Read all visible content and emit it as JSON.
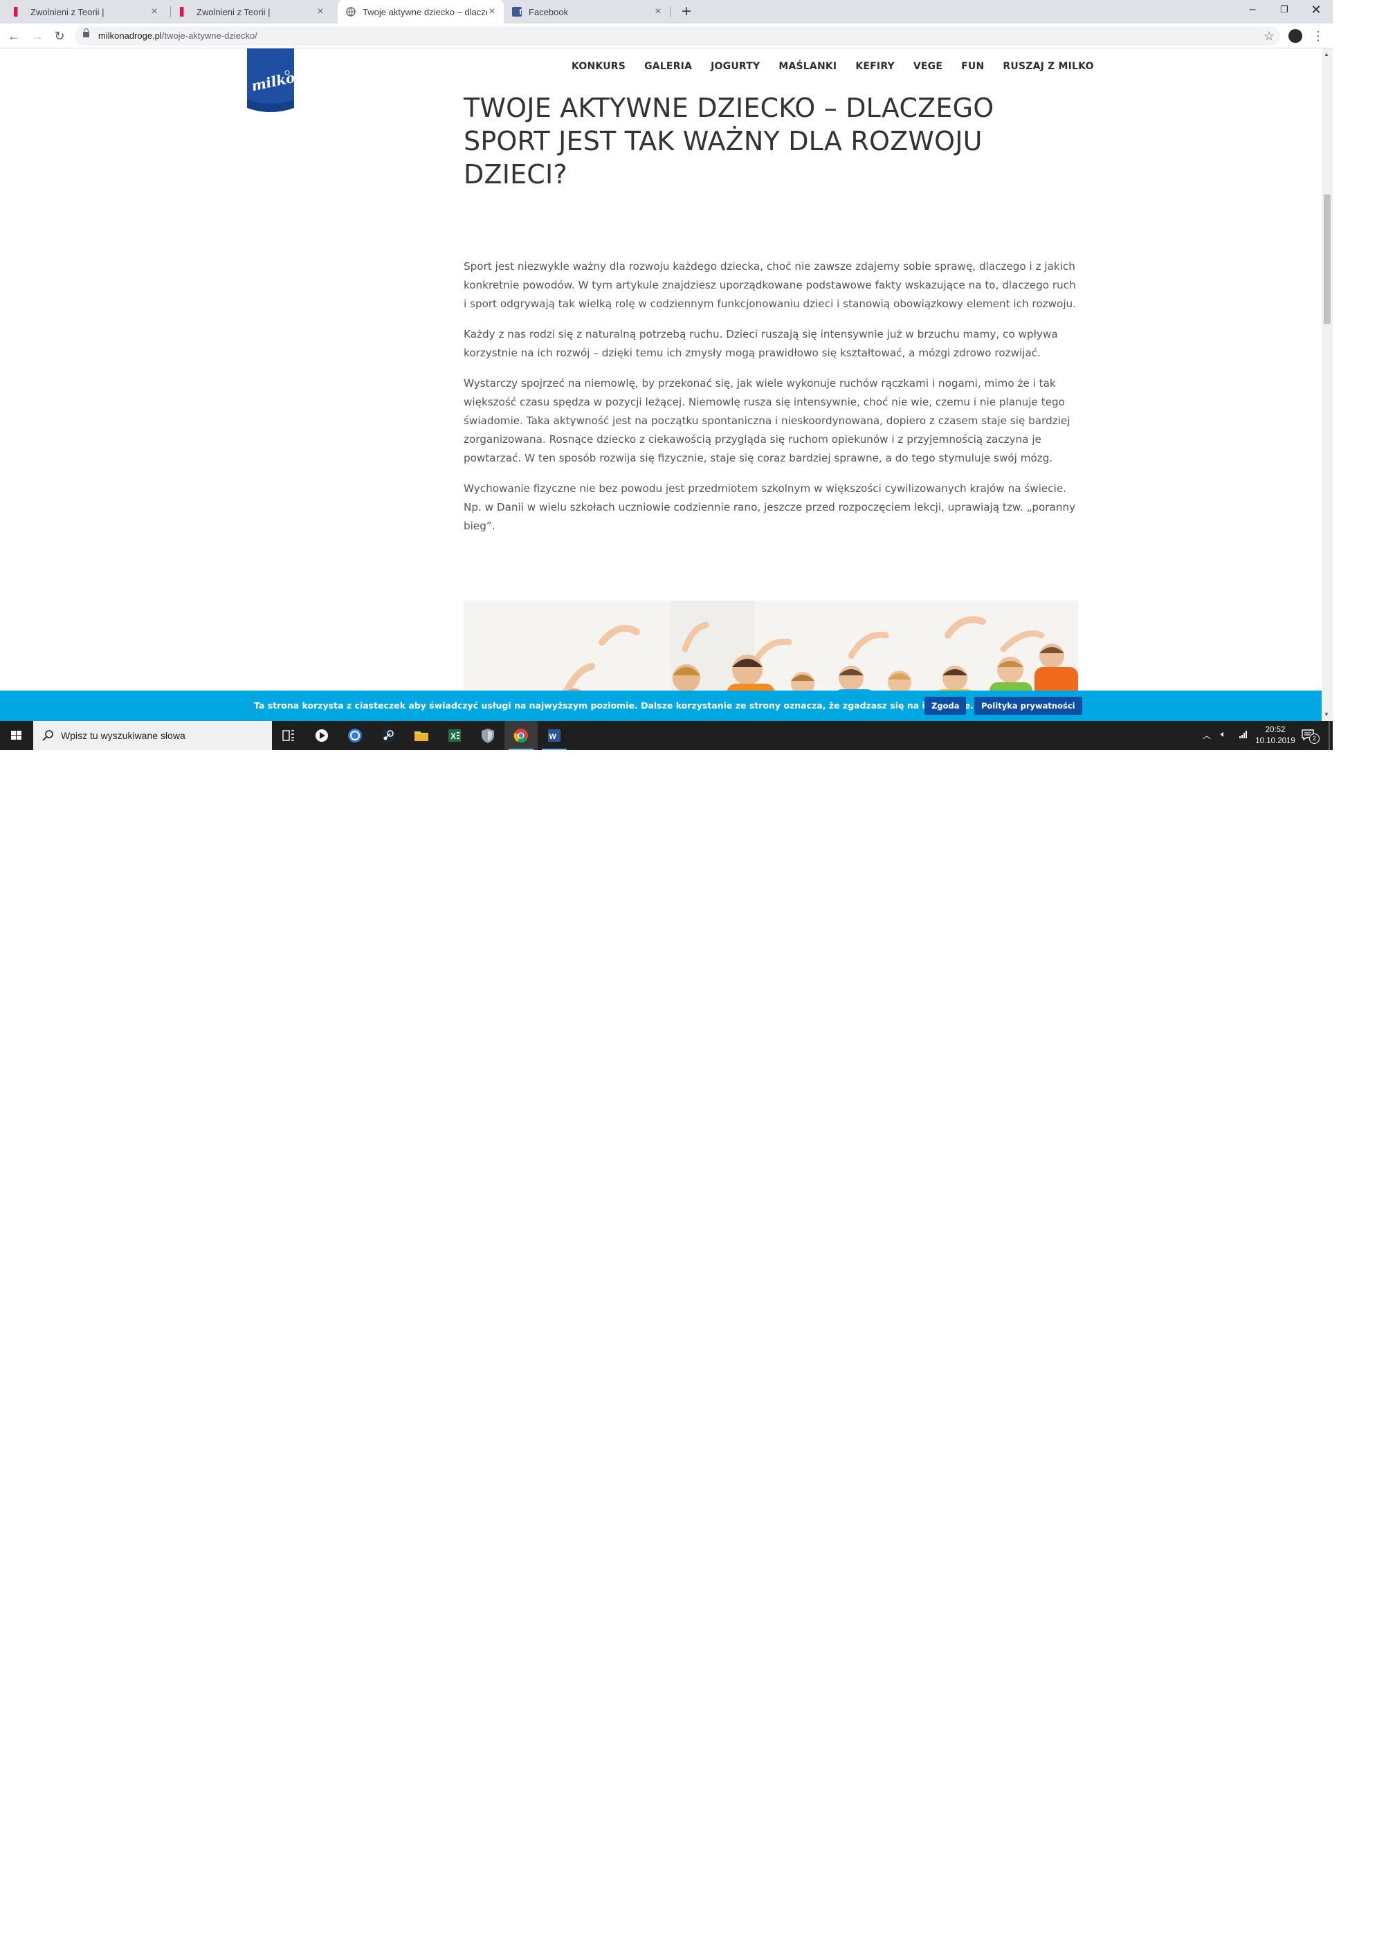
{
  "browser": {
    "tabs": [
      {
        "title": "Zwolnieni z Teorii |",
        "favicon": "zwolnieni-favicon",
        "active": false
      },
      {
        "title": "Zwolnieni z Teorii |",
        "favicon": "zwolnieni-favicon",
        "active": false
      },
      {
        "title": "Twoje aktywne dziecko – dlaczego",
        "favicon": "globe-icon",
        "active": true
      },
      {
        "title": "Facebook",
        "favicon": "facebook-icon",
        "active": false
      }
    ],
    "url_host": "milkonadroge.pl",
    "url_path": "/twoje-aktywne-dziecko/"
  },
  "site": {
    "logo_text": "milko",
    "nav": [
      "KONKURS",
      "GALERIA",
      "JOGURTY",
      "MAŚLANKI",
      "KEFIRY",
      "VEGE",
      "FUN",
      "RUSZAJ Z MILKO"
    ]
  },
  "article": {
    "title": "TWOJE AKTYWNE DZIECKO – DLACZEGO SPORT JEST TAK WAŻNY DLA ROZWOJU DZIECI?",
    "paragraphs": [
      "Sport jest niezwykle ważny dla rozwoju każdego dziecka, choć nie zawsze zdajemy sobie sprawę, dlaczego i z jakich konkretnie powodów. W tym artykule znajdziesz uporządkowane podstawowe fakty wskazujące na to, dlaczego ruch i sport odgrywają tak wielką rolę w codziennym funkcjonowaniu dzieci i stanowią obowiązkowy element ich rozwoju.",
      "Każdy z nas rodzi się z naturalną potrzebą ruchu. Dzieci ruszają się intensywnie już w brzuchu mamy, co wpływa korzystnie na ich rozwój – dzięki temu ich zmysły mogą prawidłowo się kształtować, a mózgi zdrowo rozwijać.",
      "Wystarczy spojrzeć na niemowlę, by przekonać się, jak wiele wykonuje ruchów rączkami i nogami, mimo że i tak większość czasu spędza w pozycji leżącej. Niemowlę rusza się intensywnie, choć nie wie, czemu i nie planuje tego świadomie. Taka aktywność jest na początku spontaniczna i nieskoordynowana, dopiero z czasem staje się bardziej zorganizowana. Rosnące dziecko z ciekawością przygląda się ruchom opiekunów i z przyjemnością zaczyna je powtarzać. W ten sposób rozwija się fizycznie, staje się coraz bardziej sprawne, a do tego stymuluje swój mózg.",
      "Wychowanie fizyczne nie bez powodu jest przedmiotem szkolnym w większości cywilizowanych krajów na świecie. Np. w Danii w wielu szkołach uczniowie codziennie rano, jeszcze przed rozpoczęciem lekcji, uprawiają tzw. „poranny bieg”."
    ]
  },
  "cookie_bar": {
    "text": "Ta strona korzysta z ciasteczek aby świadczyć usługi na najwyższym poziomie. Dalsze korzystanie ze strony oznacza, że zgadzasz się na ich użycie.",
    "accept_label": "Zgoda",
    "policy_label": "Polityka prywatności"
  },
  "taskbar": {
    "search_placeholder": "Wpisz tu wyszukiwane słowa",
    "time": "20:52",
    "date": "10.10.2019",
    "notification_count": "2",
    "pinned": [
      "task-view-icon",
      "media-player-icon",
      "sync-icon",
      "steam-icon",
      "file-explorer-icon",
      "excel-icon",
      "shield-app-icon",
      "chrome-icon",
      "word-icon"
    ]
  },
  "colors": {
    "cookie_bar": "#00a7e1",
    "cookie_button": "#0b4ea2",
    "logo_blue": "#1f4fa3",
    "taskbar": "#1f1f1f"
  }
}
